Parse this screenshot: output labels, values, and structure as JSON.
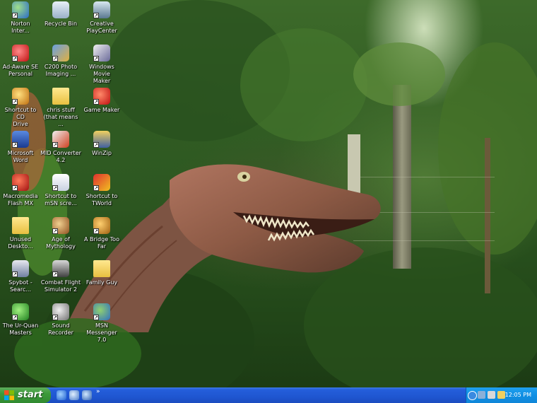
{
  "desktop": {
    "icons": [
      {
        "label": "Norton\nInter...",
        "icon": "norton-globe-icon"
      },
      {
        "label": "Recycle Bin",
        "icon": "recycle-bin-icon"
      },
      {
        "label": "Creative\nPlayCenter",
        "icon": "media-player-icon"
      },
      {
        "label": "Ad-Aware SE\nPersonal",
        "icon": "ad-aware-icon"
      },
      {
        "label": "C200 Photo\nImaging ...",
        "icon": "photo-imaging-icon"
      },
      {
        "label": "Windows Movie\nMaker",
        "icon": "movie-maker-icon"
      },
      {
        "label": "Shortcut to CD\nDrive",
        "icon": "cd-drive-icon"
      },
      {
        "label": "chris stuff\n(that means ...",
        "icon": "folder-icon"
      },
      {
        "label": "Game Maker",
        "icon": "game-maker-icon"
      },
      {
        "label": "Microsoft Word",
        "icon": "word-icon"
      },
      {
        "label": "MID Converter\n4.2",
        "icon": "mid-converter-icon"
      },
      {
        "label": "WinZip",
        "icon": "winzip-icon"
      },
      {
        "label": "Macromedia\nFlash MX",
        "icon": "flash-icon"
      },
      {
        "label": "Shortcut to\nmSN scre...",
        "icon": "document-shortcut-icon"
      },
      {
        "label": "Shortcut to\nTWorld",
        "icon": "tworld-icon"
      },
      {
        "label": "Unused\nDeskto...",
        "icon": "folder-icon"
      },
      {
        "label": "Age of\nMythology",
        "icon": "age-of-mythology-icon"
      },
      {
        "label": "A Bridge Too\nFar",
        "icon": "bridge-too-far-icon"
      },
      {
        "label": "Spybot -\nSearc...",
        "icon": "spybot-icon"
      },
      {
        "label": "Combat Flight\nSimulator 2",
        "icon": "flight-simulator-icon"
      },
      {
        "label": "Family Guy",
        "icon": "folder-icon"
      },
      {
        "label": "The Ur-Quan\nMasters",
        "icon": "ur-quan-icon"
      },
      {
        "label": "Sound\nRecorder",
        "icon": "microphone-icon"
      },
      {
        "label": "MSN\nMessenger 7.0",
        "icon": "msn-messenger-icon"
      }
    ]
  },
  "taskbar": {
    "start_label": "start",
    "quick_launch_more": "»",
    "clock": "12:05 PM"
  },
  "colors": {
    "taskbar_blue": "#245edb",
    "start_green": "#3c9a3a",
    "tray_blue": "#1190e4"
  }
}
